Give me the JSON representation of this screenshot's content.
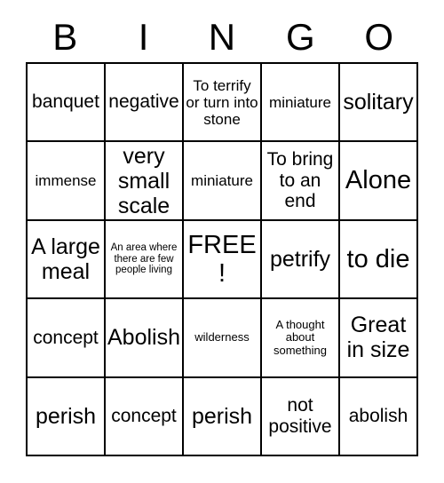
{
  "card": {
    "title_letters": [
      "B",
      "I",
      "N",
      "G",
      "O"
    ],
    "free_space_label": "FREE!",
    "colors": {
      "grid_line": "#000000",
      "background": "#ffffff",
      "text": "#000000"
    },
    "rows": [
      [
        {
          "text": "banquet",
          "size": "md"
        },
        {
          "text": "negative",
          "size": "md"
        },
        {
          "text": "To terrify or turn into stone",
          "size": "sm"
        },
        {
          "text": "miniature",
          "size": "sm"
        },
        {
          "text": "solitary",
          "size": "lg"
        }
      ],
      [
        {
          "text": "immense",
          "size": "sm"
        },
        {
          "text": "very small scale",
          "size": "lg"
        },
        {
          "text": "miniature",
          "size": "sm"
        },
        {
          "text": "To bring to an end",
          "size": "md"
        },
        {
          "text": "Alone",
          "size": "xl"
        }
      ],
      [
        {
          "text": "A large meal",
          "size": "lg"
        },
        {
          "text": "An area where there are few people living",
          "size": "xxs"
        },
        {
          "text": "FREE!",
          "size": "xl"
        },
        {
          "text": "petrify",
          "size": "lg"
        },
        {
          "text": "to die",
          "size": "xl"
        }
      ],
      [
        {
          "text": "concept",
          "size": "md"
        },
        {
          "text": "Abolish",
          "size": "lg"
        },
        {
          "text": "wilderness",
          "size": "xs"
        },
        {
          "text": "A thought about something",
          "size": "xs"
        },
        {
          "text": "Great in size",
          "size": "lg"
        }
      ],
      [
        {
          "text": "perish",
          "size": "lg"
        },
        {
          "text": "concept",
          "size": "md"
        },
        {
          "text": "perish",
          "size": "lg"
        },
        {
          "text": "not positive",
          "size": "md"
        },
        {
          "text": "abolish",
          "size": "md"
        }
      ]
    ]
  }
}
